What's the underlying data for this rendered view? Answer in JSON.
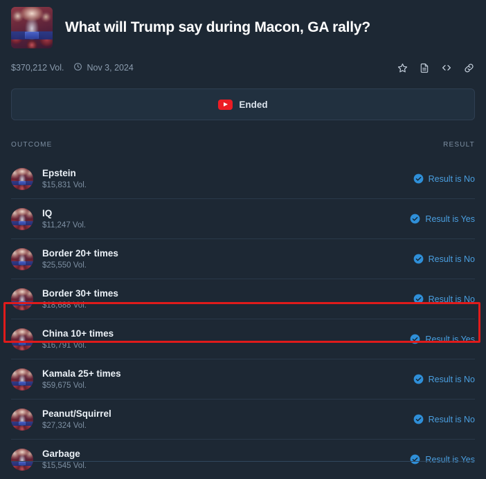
{
  "header": {
    "title": "What will Trump say during Macon, GA rally?",
    "thumbnail_alt": "trump-rally-photo"
  },
  "meta": {
    "volume": "$370,212 Vol.",
    "date": "Nov 3, 2024",
    "clock_icon": "clock-icon",
    "actions": [
      {
        "name": "star-icon",
        "label": "Favorite"
      },
      {
        "name": "document-icon",
        "label": "Rules"
      },
      {
        "name": "code-icon",
        "label": "Embed"
      },
      {
        "name": "link-icon",
        "label": "Copy link"
      }
    ]
  },
  "status_bar": {
    "icon": "youtube-play-icon",
    "label": "Ended"
  },
  "table": {
    "columns": {
      "outcome": "OUTCOME",
      "result": "RESULT"
    },
    "rows": [
      {
        "name": "Epstein",
        "volume": "$15,831 Vol.",
        "result": "Result is No",
        "result_value": "No",
        "highlighted": false
      },
      {
        "name": "IQ",
        "volume": "$11,247 Vol.",
        "result": "Result is Yes",
        "result_value": "Yes",
        "highlighted": false
      },
      {
        "name": "Border 20+ times",
        "volume": "$25,550 Vol.",
        "result": "Result is No",
        "result_value": "No",
        "highlighted": false
      },
      {
        "name": "Border 30+ times",
        "volume": "$18,688 Vol.",
        "result": "Result is No",
        "result_value": "No",
        "highlighted": false
      },
      {
        "name": "China 10+ times",
        "volume": "$16,791 Vol.",
        "result": "Result is Yes",
        "result_value": "Yes",
        "highlighted": true
      },
      {
        "name": "Kamala 25+ times",
        "volume": "$59,675 Vol.",
        "result": "Result is No",
        "result_value": "No",
        "highlighted": false
      },
      {
        "name": "Peanut/Squirrel",
        "volume": "$27,324 Vol.",
        "result": "Result is No",
        "result_value": "No",
        "highlighted": false
      },
      {
        "name": "Garbage",
        "volume": "$15,545 Vol.",
        "result": "Result is Yes",
        "result_value": "Yes",
        "highlighted": false
      }
    ]
  },
  "annotation": {
    "type": "red-rectangle-highlight",
    "target_row": "China 10+ times",
    "color": "#e01b1b"
  },
  "colors": {
    "background": "#1d2834",
    "accent_blue": "#4a9fe0",
    "muted_text": "#7e90a3",
    "youtube_red": "#ec1c24",
    "divider": "#2a394a"
  }
}
